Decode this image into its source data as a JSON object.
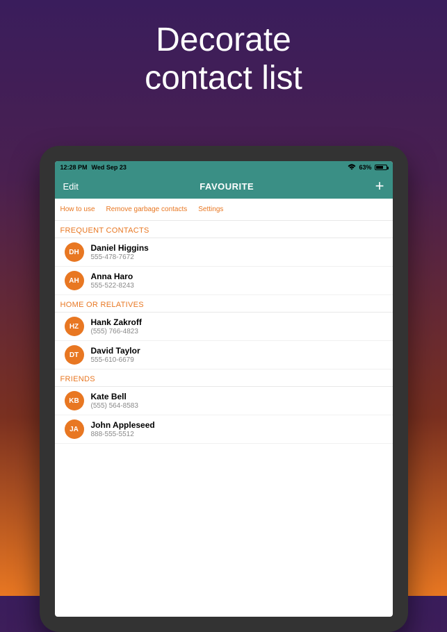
{
  "promo": {
    "line1": "Decorate",
    "line2": "contact list"
  },
  "status": {
    "time": "12:28 PM",
    "date": "Wed Sep 23",
    "battery_pct": "63%"
  },
  "nav": {
    "edit": "Edit",
    "title": "FAVOURITE",
    "add": "+"
  },
  "toolbar": {
    "howto": "How to use",
    "remove": "Remove garbage contacts",
    "settings": "Settings"
  },
  "sections": [
    {
      "title": "FREQUENT CONTACTS",
      "items": [
        {
          "initials": "DH",
          "name": "Daniel Higgins",
          "phone": "555-478-7672"
        },
        {
          "initials": "AH",
          "name": "Anna Haro",
          "phone": "555-522-8243"
        }
      ]
    },
    {
      "title": "HOME OR RELATIVES",
      "items": [
        {
          "initials": "HZ",
          "name": "Hank Zakroff",
          "phone": "(555) 766-4823"
        },
        {
          "initials": "DT",
          "name": "David Taylor",
          "phone": "555-610-6679"
        }
      ]
    },
    {
      "title": "FRIENDS",
      "items": [
        {
          "initials": "KB",
          "name": "Kate Bell",
          "phone": "(555) 564-8583"
        },
        {
          "initials": "JA",
          "name": "John Appleseed",
          "phone": "888-555-5512"
        }
      ]
    }
  ],
  "colors": {
    "accent": "#e87722",
    "navbg": "#3a8f85"
  }
}
